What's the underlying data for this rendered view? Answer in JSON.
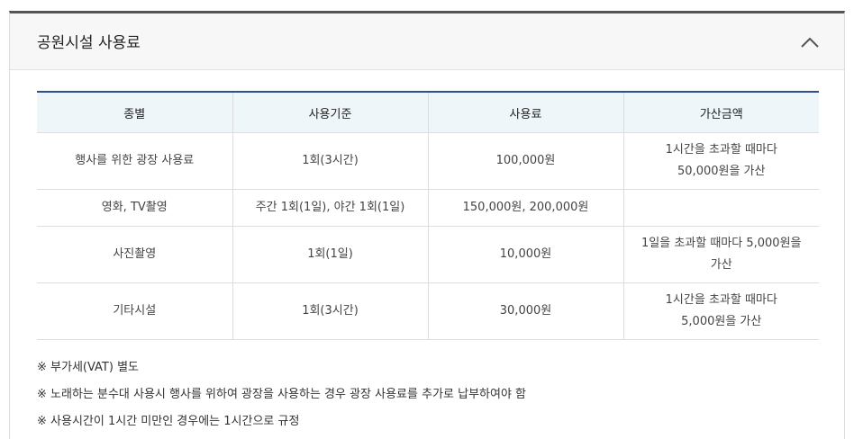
{
  "panel": {
    "title": "공원시설 사용료",
    "toggle_icon": "chevron-up-icon"
  },
  "table": {
    "headers": [
      "종별",
      "사용기준",
      "사용료",
      "가산금액"
    ],
    "rows": [
      {
        "type": "행사를 위한 광장 사용료",
        "basis": "1회(3시간)",
        "fee": "100,000원",
        "surcharge": [
          "1시간을 초과할 때마다",
          "50,000원을 가산"
        ]
      },
      {
        "type": "영화, TV촬영",
        "basis": "주간 1회(1일), 야간 1회(1일)",
        "fee": "150,000원, 200,000원",
        "surcharge": [
          "",
          ""
        ]
      },
      {
        "type": "사진촬영",
        "basis": "1회(1일)",
        "fee": "10,000원",
        "surcharge": [
          "1일을 초과할 때마다 5,000원을",
          "가산"
        ]
      },
      {
        "type": "기타시설",
        "basis": "1회(3시간)",
        "fee": "30,000원",
        "surcharge": [
          "1시간을 초과할 때마다",
          "5,000원을 가산"
        ]
      }
    ]
  },
  "notes": [
    "※ 부가세(VAT) 별도",
    "※ 노래하는 분수대 사용시 행사를 위하여 광장을 사용하는 경우 광장 사용료를 추가로 납부하여야 함",
    "※ 사용시간이 1시간 미만인 경우에는 1시간으로 규정"
  ],
  "colors": {
    "header_border": "#555555",
    "table_top_border": "#2e4f8f",
    "table_header_bg": "#eef6fa"
  }
}
